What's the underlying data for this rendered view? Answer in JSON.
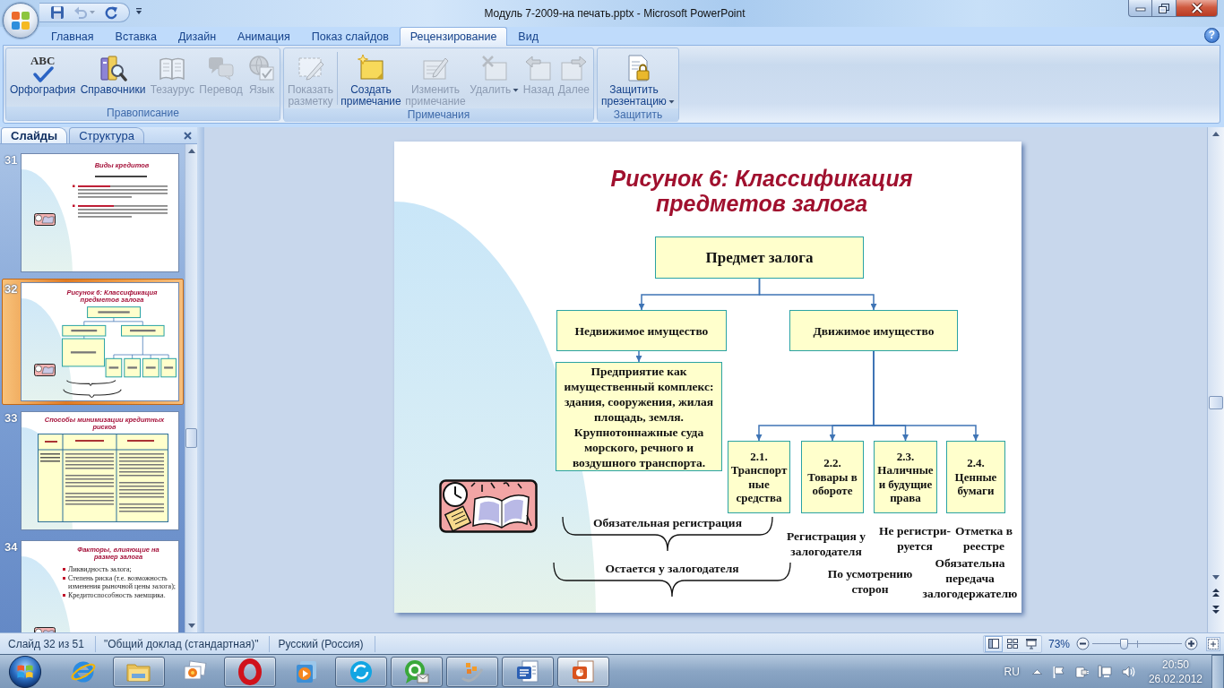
{
  "window": {
    "title": "Модуль 7-2009-на печать.pptx - Microsoft PowerPoint"
  },
  "quick_access": [
    {
      "kind": "save",
      "disabled": false
    },
    {
      "kind": "undo",
      "disabled": true,
      "dropdown": true
    },
    {
      "kind": "redo",
      "disabled": false
    }
  ],
  "ribbon_tabs": [
    {
      "label": "Главная",
      "selected": false
    },
    {
      "label": "Вставка",
      "selected": false
    },
    {
      "label": "Дизайн",
      "selected": false
    },
    {
      "label": "Анимация",
      "selected": false
    },
    {
      "label": "Показ слайдов",
      "selected": false
    },
    {
      "label": "Рецензирование",
      "selected": true
    },
    {
      "label": "Вид",
      "selected": false
    }
  ],
  "help": "?",
  "ribbon_groups": [
    {
      "label": "Правописание",
      "buttons": [
        {
          "kind": "spelling",
          "label": "Орфография",
          "icon_text": "ABC",
          "disabled": false
        },
        {
          "kind": "research",
          "label": "Справочники",
          "disabled": false
        },
        {
          "kind": "thesaurus",
          "label": "Тезаурус",
          "disabled": true
        },
        {
          "kind": "translate",
          "label": "Перевод",
          "disabled": true
        },
        {
          "kind": "language",
          "label": "Язык",
          "disabled": true
        }
      ]
    },
    {
      "label": "Примечания",
      "buttons": [
        {
          "kind": "markup",
          "label": "Показать разметку",
          "disabled": true
        },
        {
          "kind": "new_comment",
          "label": "Создать примечание",
          "disabled": false,
          "separator_before": true
        },
        {
          "kind": "edit_comment",
          "label": "Изменить примечание",
          "disabled": true
        },
        {
          "kind": "delete",
          "label": "Удалить",
          "disabled": true,
          "dropdown": true
        },
        {
          "kind": "previous",
          "label": "Назад",
          "disabled": true
        },
        {
          "kind": "next",
          "label": "Далее",
          "disabled": true
        }
      ]
    },
    {
      "label": "Защитить",
      "buttons": [
        {
          "kind": "protect",
          "label": "Защитить презентацию",
          "disabled": false,
          "dropdown": true
        }
      ]
    }
  ],
  "slides_pane": {
    "tabs": [
      {
        "label": "Слайды",
        "selected": true
      },
      {
        "label": "Структура",
        "selected": false
      }
    ],
    "thumbnails": [
      {
        "number": "31",
        "kind": "text",
        "title": "Виды кредитов",
        "selected": false
      },
      {
        "number": "32",
        "kind": "diagram",
        "title": "Рисунок 6: Классификация предметов залога",
        "selected": true
      },
      {
        "number": "33",
        "kind": "table",
        "title": "Способы минимизации кредитных рисков",
        "selected": false
      },
      {
        "number": "34",
        "kind": "bullets",
        "title": "Факторы, влияющие на размер залога",
        "selected": false,
        "bullets": [
          "Ликвидность залога;",
          "Степень риска (т.е. возможность изменения рыночной цены залога);",
          "Кредитоспособность заемщика."
        ]
      }
    ]
  },
  "slide": {
    "title": "Рисунок 6: Классификация предметов залога",
    "root": "Предмет залога",
    "branches": [
      {
        "label": "Недвижимое имущество",
        "children": [
          {
            "label": "Предприятие как имущественный комплекс: здания, сооружения, жилая площадь, земля. Крупнотоннажные суда морского, речного и воздушного транспорта."
          }
        ]
      },
      {
        "label": "Движимое имущество",
        "children": [
          {
            "label": "2.1. Транспортные средства"
          },
          {
            "label": "2.2. Товары в обороте"
          },
          {
            "label": "2.3. Наличные и будущие права"
          },
          {
            "label": "2.4. Ценные бумаги"
          }
        ]
      }
    ],
    "notes": [
      {
        "kind": "brace",
        "text": "Обязательная регистрация"
      },
      {
        "kind": "plain",
        "text": "Регистрация у залогодателя"
      },
      {
        "kind": "plain",
        "text": "Не регистри-руется"
      },
      {
        "kind": "plain",
        "text": "Отметка в реестре"
      },
      {
        "kind": "brace",
        "text": "Остается у залогодателя"
      },
      {
        "kind": "plain",
        "text": "По усмотрению сторон"
      },
      {
        "kind": "plain",
        "text": "Обязательна передача залогодержателю"
      }
    ]
  },
  "status_bar": {
    "slide": "Слайд 32 из 51",
    "theme": "\"Общий доклад (стандартная)\"",
    "language": "Русский (Россия)",
    "views": [
      {
        "kind": "normal",
        "selected": true
      },
      {
        "kind": "sorter",
        "selected": false
      },
      {
        "kind": "show",
        "selected": false
      }
    ],
    "zoom": "73%",
    "zoom_slider": {
      "level": 0.35
    }
  },
  "taskbar": {
    "apps": [
      {
        "kind": "ie",
        "running": false,
        "selected": false
      },
      {
        "kind": "explorer",
        "running": true,
        "selected": false
      },
      {
        "kind": "gallery",
        "running": false,
        "selected": false
      },
      {
        "kind": "opera",
        "running": true,
        "selected": false
      },
      {
        "kind": "player",
        "running": false,
        "selected": false
      },
      {
        "kind": "skype",
        "running": true,
        "selected": false
      },
      {
        "kind": "messenger",
        "running": true,
        "selected": false
      },
      {
        "kind": "organizer",
        "running": true,
        "selected": false
      },
      {
        "kind": "word",
        "running": true,
        "selected": false
      },
      {
        "kind": "powerpoint",
        "running": true,
        "selected": true
      }
    ],
    "tray": {
      "language": "RU",
      "time": "20:50",
      "date": "26.02.2012"
    }
  }
}
